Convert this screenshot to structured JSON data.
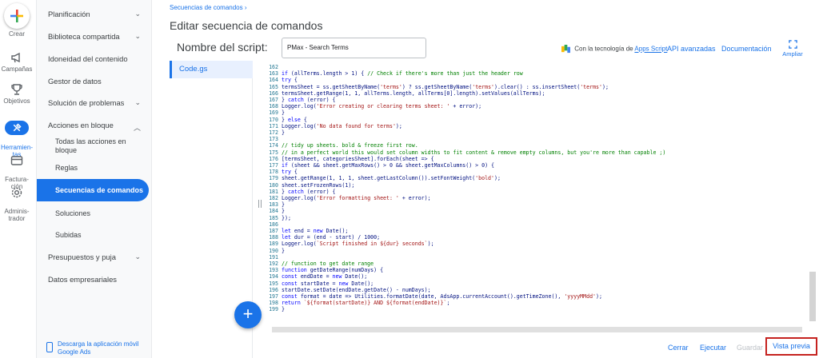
{
  "rail": {
    "create_label": "Crear",
    "items": [
      {
        "label": "Campañas",
        "icon": "megaphone-icon"
      },
      {
        "label": "Objetivos",
        "icon": "trophy-icon"
      },
      {
        "label": "Herramien-\ntas",
        "icon": "tools-icon"
      },
      {
        "label": "Factura-\nción",
        "icon": "credit-card-icon"
      },
      {
        "label": "Adminis-\ntrador",
        "icon": "gear-icon"
      }
    ]
  },
  "nav": {
    "items": [
      {
        "label": "Planificación"
      },
      {
        "label": "Biblioteca compartida"
      },
      {
        "label": "Idoneidad del contenido"
      },
      {
        "label": "Gestor de datos"
      },
      {
        "label": "Solución de problemas"
      },
      {
        "label": "Acciones en bloque"
      },
      {
        "label": "Presupuestos y puja"
      },
      {
        "label": "Datos empresariales"
      }
    ],
    "sub_items": [
      {
        "label": "Todas las acciones en bloque"
      },
      {
        "label": "Reglas"
      },
      {
        "label": "Secuencias de comandos"
      },
      {
        "label": "Soluciones"
      },
      {
        "label": "Subidas"
      }
    ],
    "download_label": "Descarga la aplicación móvil Google Ads"
  },
  "header": {
    "breadcrumb": "Secuencias de comandos ›",
    "title": "Editar secuencia de comandos",
    "script_name_label": "Nombre del script:",
    "script_name_value": "PMax - Search Terms",
    "powered_prefix": "Con la tecnología de ",
    "powered_link": "Apps Script",
    "advanced_api": "API avanzadas",
    "documentation": "Documentación",
    "expand": "Ampliar"
  },
  "files": [
    {
      "name": "Code.gs"
    }
  ],
  "code": {
    "colors": {
      "keyword": "#0000ff",
      "comment": "#008000",
      "string": "#a31515",
      "text": "#001080",
      "plain": "#000000"
    },
    "lines": [
      {
        "n": "162",
        "t": ""
      },
      {
        "n": "163",
        "t": "if (allTerms.length > 1) { // Check if there's more than just the header row"
      },
      {
        "n": "164",
        "t": "try {"
      },
      {
        "n": "165",
        "t": "termsSheet = ss.getSheetByName('terms') ? ss.getSheetByName('terms').clear() : ss.insertSheet('terms');"
      },
      {
        "n": "166",
        "t": "termsSheet.getRange(1, 1, allTerms.length, allTerms[0].length).setValues(allTerms);"
      },
      {
        "n": "167",
        "t": "} catch (error) {"
      },
      {
        "n": "168",
        "t": "Logger.log('Error creating or clearing terms sheet: ' + error);"
      },
      {
        "n": "169",
        "t": "}"
      },
      {
        "n": "170",
        "t": "} else {"
      },
      {
        "n": "171",
        "t": "Logger.log('No data found for terms');"
      },
      {
        "n": "172",
        "t": "}"
      },
      {
        "n": "173",
        "t": ""
      },
      {
        "n": "174",
        "t": "// tidy up sheets. bold & freeze first row."
      },
      {
        "n": "175",
        "t": "// in a perfect world this would set column widths to fit content & remove empty columns, but you're more than capable ;)"
      },
      {
        "n": "176",
        "t": "[termsSheet, categoriesSheet].forEach(sheet => {"
      },
      {
        "n": "177",
        "t": "if (sheet && sheet.getMaxRows() > 0 && sheet.getMaxColumns() > 0) {"
      },
      {
        "n": "178",
        "t": "try {"
      },
      {
        "n": "179",
        "t": "sheet.getRange(1, 1, 1, sheet.getLastColumn()).setFontWeight('bold');"
      },
      {
        "n": "180",
        "t": "sheet.setFrozenRows(1);"
      },
      {
        "n": "181",
        "t": "} catch (error) {"
      },
      {
        "n": "182",
        "t": "Logger.log('Error formatting sheet: ' + error);"
      },
      {
        "n": "183",
        "t": "}"
      },
      {
        "n": "184",
        "t": "}"
      },
      {
        "n": "185",
        "t": "});"
      },
      {
        "n": "186",
        "t": ""
      },
      {
        "n": "187",
        "t": "let end = new Date();"
      },
      {
        "n": "188",
        "t": "let dur = (end - start) / 1000;"
      },
      {
        "n": "189",
        "t": "Logger.log(`Script finished in ${dur} seconds`);"
      },
      {
        "n": "190",
        "t": "}"
      },
      {
        "n": "191",
        "t": ""
      },
      {
        "n": "192",
        "t": "// function to get date range"
      },
      {
        "n": "193",
        "t": "function getDateRange(numDays) {"
      },
      {
        "n": "194",
        "t": "const endDate = new Date();"
      },
      {
        "n": "195",
        "t": "const startDate = new Date();"
      },
      {
        "n": "196",
        "t": "startDate.setDate(endDate.getDate() - numDays);"
      },
      {
        "n": "197",
        "t": "const format = date => Utilities.formatDate(date, AdsApp.currentAccount().getTimeZone(), 'yyyyMMdd');"
      },
      {
        "n": "198",
        "t": "return `${format(startDate)} AND ${format(endDate)}`;"
      },
      {
        "n": "199",
        "t": "}"
      }
    ]
  },
  "footer": {
    "cancel": "Cerrar",
    "run": "Ejecutar",
    "save": "Guardar",
    "preview": "Vista previa"
  }
}
